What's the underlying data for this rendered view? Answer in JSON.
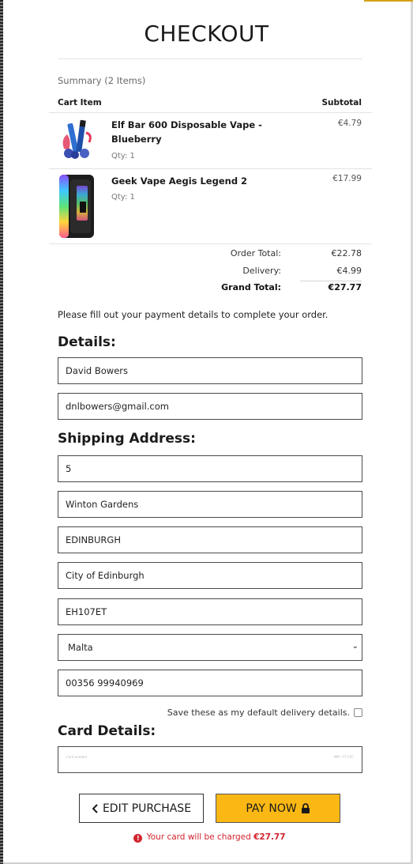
{
  "page": {
    "title": "CHECKOUT"
  },
  "summary": {
    "label": "Summary (2 Items)",
    "col_item": "Cart Item",
    "col_subtotal": "Subtotal"
  },
  "items": [
    {
      "name": "Elf Bar 600 Disposable Vape - Blueberry",
      "qty": "Qty: 1",
      "price": "€4.79"
    },
    {
      "name": "Geek Vape Aegis Legend 2",
      "qty": "Qty: 1",
      "price": "€17.99"
    }
  ],
  "totals": {
    "order_label": "Order Total:",
    "order_value": "€22.78",
    "delivery_label": "Delivery:",
    "delivery_value": "€4.99",
    "grand_label": "Grand Total:",
    "grand_value": "€27.77"
  },
  "instructions": "Please fill out your payment details to complete your order.",
  "details": {
    "heading": "Details:",
    "name": "David Bowers",
    "email": "dnlbowers@gmail.com"
  },
  "shipping": {
    "heading": "Shipping Address:",
    "house": "5",
    "street": "Winton Gardens",
    "town": "EDINBURGH",
    "county": "City of Edinburgh",
    "postcode": "EH107ET",
    "country": "Malta",
    "phone": "00356 99940969",
    "save_default_label": "Save these as my default delivery details."
  },
  "card": {
    "heading": "Card Details:",
    "placeholder_number": "Card number",
    "placeholder_expiry": "MM / YY CVC"
  },
  "actions": {
    "edit_label": "EDIT PURCHASE",
    "pay_label": "PAY NOW",
    "charge_text": "Your card will be charged",
    "charge_amount": "€27.77"
  },
  "colors": {
    "accent": "#fbb814",
    "error": "#d1242f"
  },
  "icons": {
    "edit": "chevron-left-icon",
    "pay": "lock-icon",
    "warning": "exclamation-circle-icon"
  }
}
